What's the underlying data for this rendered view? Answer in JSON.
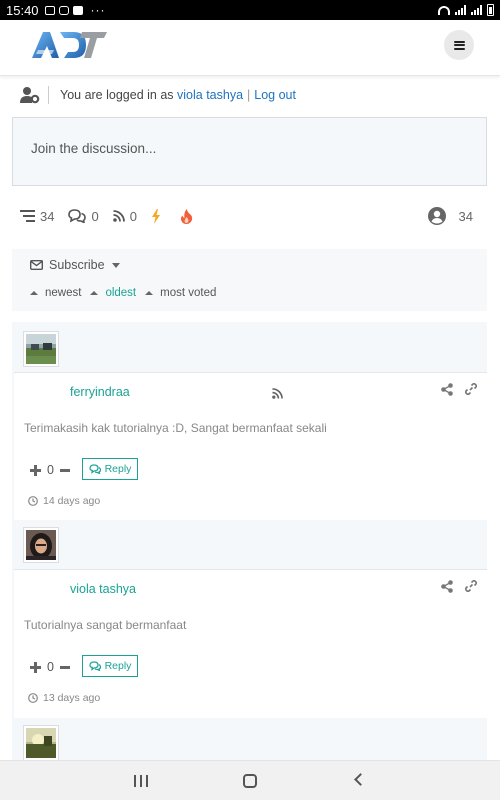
{
  "status_bar": {
    "time": "15:40",
    "more": "···"
  },
  "header": {
    "logo_text": "ADT",
    "menu_icon": "hamburger-icon"
  },
  "login": {
    "prefix": "You are logged in as",
    "username": "viola tashya",
    "separator": "|",
    "logout": "Log out",
    "icon": "user-cog-icon"
  },
  "discussion": {
    "placeholder": "Join the discussion..."
  },
  "stats": {
    "threads": "34",
    "replies": "0",
    "followers": "0",
    "participants": "34"
  },
  "filters": {
    "subscribe": "Subscribe",
    "sort": [
      {
        "label": "newest",
        "active": false
      },
      {
        "label": "oldest",
        "active": true
      },
      {
        "label": "most voted",
        "active": false
      }
    ]
  },
  "comments": [
    {
      "author": "ferryindraa",
      "text": "Terimakasih kak tutorialnya :D, Sangat bermanfaat sekali",
      "votes": "0",
      "reply": "Reply",
      "time": "14 days ago"
    },
    {
      "author": "viola tashya",
      "text": "Tutorialnya sangat bermanfaat",
      "votes": "0",
      "reply": "Reply",
      "time": "13 days ago"
    }
  ],
  "colors": {
    "accent": "#1aa394",
    "link": "#1e73be",
    "lightning": "#f5a623",
    "fire": "#f25f3a"
  }
}
